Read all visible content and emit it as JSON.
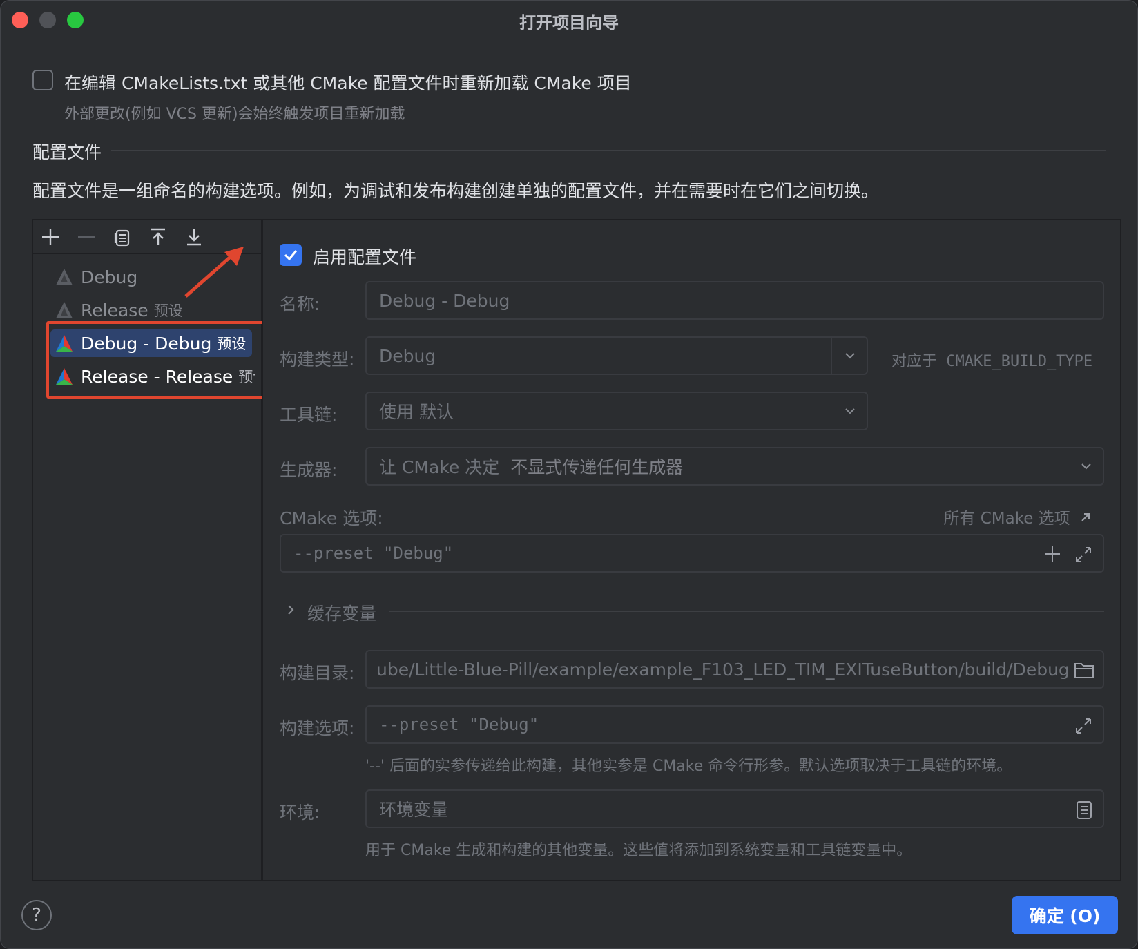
{
  "window": {
    "title": "打开项目向导"
  },
  "reload_option": {
    "label": "在编辑 CMakeLists.txt 或其他 CMake 配置文件时重新加载 CMake 项目",
    "hint": "外部更改(例如 VCS 更新)会始终触发项目重新加载",
    "checked": false
  },
  "profiles_section": {
    "heading": "配置文件",
    "description": "配置文件是一组命名的构建选项。例如，为调试和发布构建创建单独的配置文件，并在需要时在它们之间切换。"
  },
  "toolbar": {
    "icons": [
      "add-icon",
      "remove-icon",
      "copy-icon",
      "move-up-icon",
      "move-down-icon"
    ]
  },
  "profiles": [
    {
      "name": "Debug",
      "preset": "",
      "enabled": false,
      "selected": false
    },
    {
      "name": "Release",
      "preset": "预设",
      "enabled": false,
      "selected": false
    },
    {
      "name": "Debug - Debug",
      "preset": "预设",
      "enabled": true,
      "selected": true
    },
    {
      "name": "Release - Release",
      "preset": "预设",
      "enabled": true,
      "selected": false
    }
  ],
  "form": {
    "enable_label": "启用配置文件",
    "enable_checked": true,
    "name_label": "名称:",
    "name_value": "Debug - Debug",
    "build_type_label": "构建类型:",
    "build_type_value": "Debug",
    "build_type_hint": "对应于 CMAKE_BUILD_TYPE",
    "toolchain_label": "工具链:",
    "toolchain_value": "使用  默认",
    "generator_label": "生成器:",
    "generator_value": "让 CMake 决定",
    "generator_hint": "不显式传递任何生成器",
    "cmake_options_label": "CMake 选项:",
    "cmake_options_link": "所有 CMake 选项",
    "cmake_options_value": "--preset \"Debug\"",
    "cache_vars_label": "缓存变量",
    "build_dir_label": "构建目录:",
    "build_dir_value": "ube/Little-Blue-Pill/example/example_F103_LED_TIM_EXITuseButton/build/Debug",
    "build_options_label": "构建选项:",
    "build_options_value": "--preset \"Debug\"",
    "build_options_hint": "'--' 后面的实参传递给此构建，其他实参是 CMake 命令行形参。默认选项取决于工具链的环境。",
    "env_label": "环境:",
    "env_value": "环境变量",
    "env_hint": "用于 CMake 生成和构建的其他变量。这些值将添加到系统变量和工具链变量中。"
  },
  "footer": {
    "help_label": "?",
    "ok_label": "确定 (O)"
  },
  "colors": {
    "accent": "#3574f0",
    "highlight": "#e0462f",
    "selection": "#2e436e"
  }
}
